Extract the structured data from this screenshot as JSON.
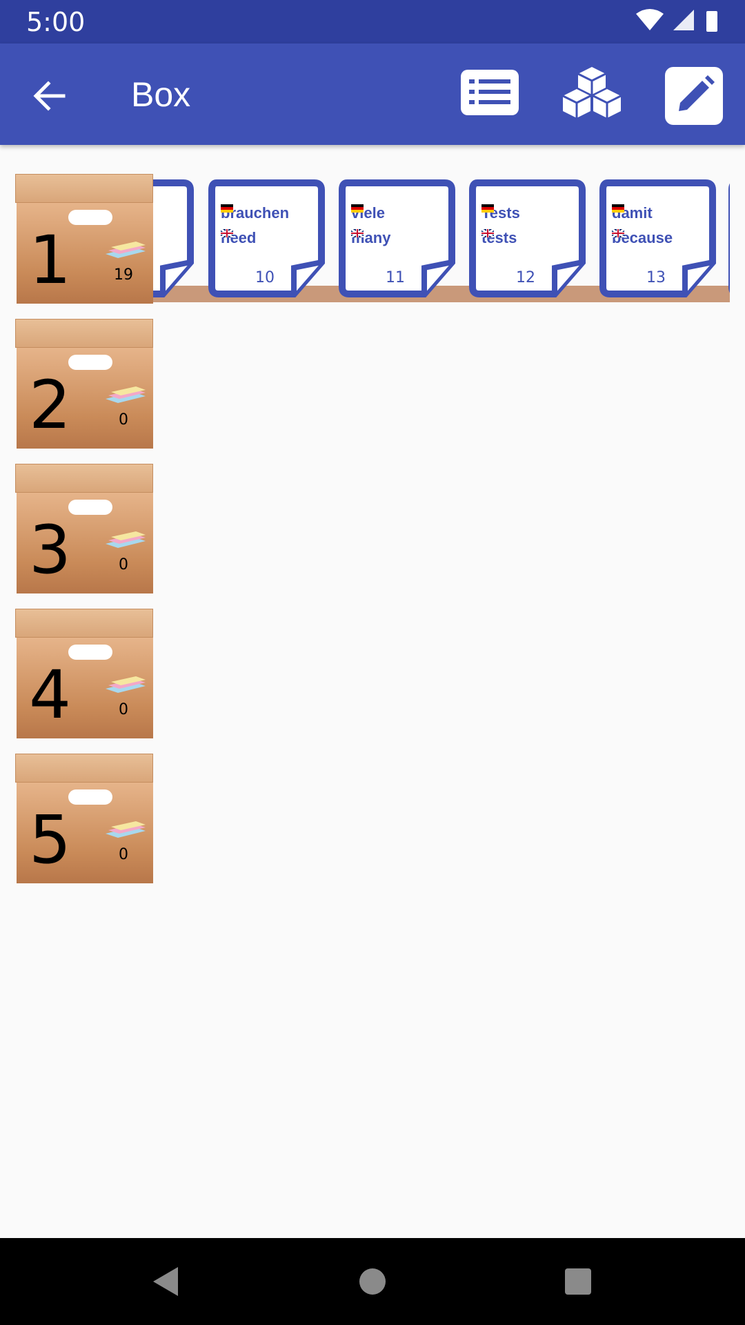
{
  "status_bar": {
    "time": "5:00"
  },
  "app_bar": {
    "title": "Box"
  },
  "boxes": [
    {
      "number": "1",
      "count": "19"
    },
    {
      "number": "2",
      "count": "0"
    },
    {
      "number": "3",
      "count": "0"
    },
    {
      "number": "4",
      "count": "0"
    },
    {
      "number": "5",
      "count": "0"
    }
  ],
  "cards": [
    {
      "de": "brauchen",
      "en": "need",
      "number": "10"
    },
    {
      "de": "viele",
      "en": "many",
      "number": "11"
    },
    {
      "de": "Tests",
      "en": "tests",
      "number": "12"
    },
    {
      "de": "damit",
      "en": "because",
      "number": "13"
    }
  ],
  "colors": {
    "primary": "#3f51b5",
    "primary_dark": "#2f3f9e",
    "box": "#c98a58"
  }
}
